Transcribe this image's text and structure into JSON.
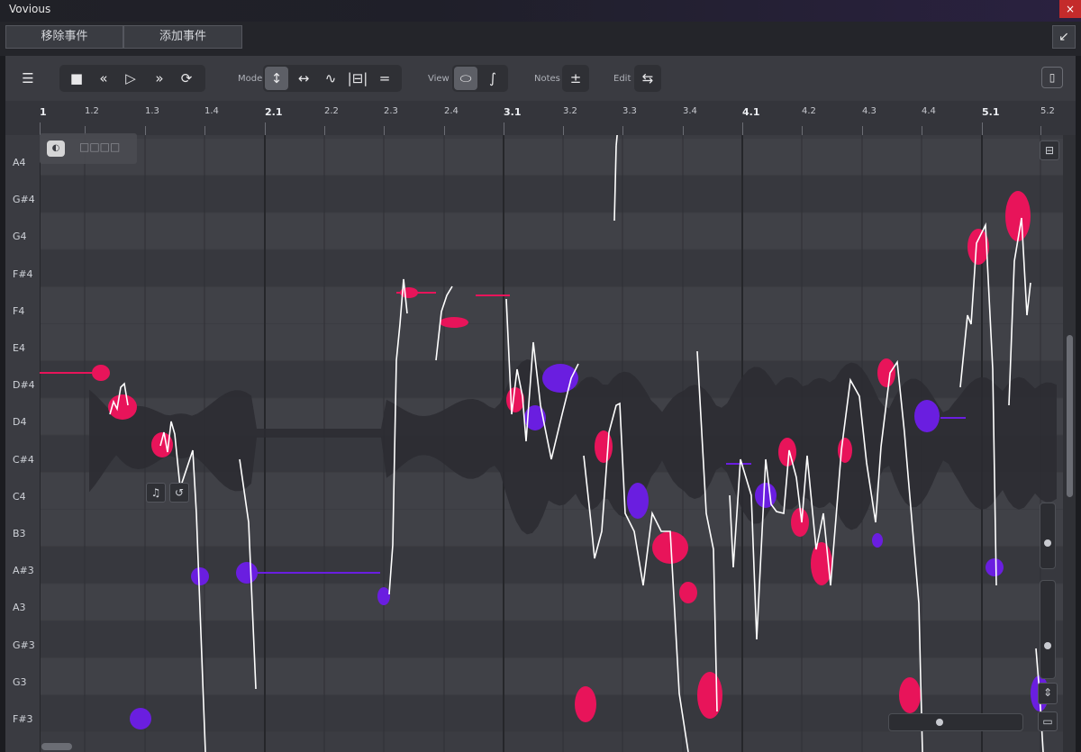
{
  "window": {
    "title": "Vovious",
    "close_label": "×"
  },
  "event_bar": {
    "remove_event": "移除事件",
    "add_event": "添加事件",
    "dock_icon": "arrow-down-left-icon"
  },
  "toolbar": {
    "menu_icon": "hamburger-icon",
    "transport": [
      "stop-icon",
      "rewind-icon",
      "play-icon",
      "fast-forward-icon",
      "loop-icon"
    ],
    "mode_label": "Mode",
    "mode_tools": [
      "pitch-vertical-icon",
      "time-horizontal-icon",
      "curve-tool-icon",
      "range-tool-icon",
      "equal-icon"
    ],
    "view_label": "View",
    "view_tools": [
      "blob-view-icon",
      "curve-view-icon"
    ],
    "notes_label": "Notes",
    "notes_icon": "plus-minus-icon",
    "edit_label": "Edit",
    "edit_icon": "swap-icon",
    "panel_icon": "side-panel-icon"
  },
  "ruler": {
    "ticks": [
      {
        "label": "1",
        "major": true
      },
      {
        "label": "1.2",
        "major": false
      },
      {
        "label": "1.3",
        "major": false
      },
      {
        "label": "1.4",
        "major": false
      },
      {
        "label": "2.1",
        "major": true
      },
      {
        "label": "2.2",
        "major": false
      },
      {
        "label": "2.3",
        "major": false
      },
      {
        "label": "2.4",
        "major": false
      },
      {
        "label": "3.1",
        "major": true
      },
      {
        "label": "3.2",
        "major": false
      },
      {
        "label": "3.3",
        "major": false
      },
      {
        "label": "3.4",
        "major": false
      },
      {
        "label": "4.1",
        "major": true
      },
      {
        "label": "4.2",
        "major": false
      },
      {
        "label": "4.3",
        "major": false
      },
      {
        "label": "4.4",
        "major": false
      },
      {
        "label": "5.1",
        "major": true
      },
      {
        "label": "5.2",
        "major": false
      }
    ]
  },
  "piano_keys": [
    "A4",
    "G#4",
    "G4",
    "F#4",
    "F4",
    "E4",
    "D#4",
    "D4",
    "C#4",
    "C4",
    "B3",
    "A#3",
    "A3",
    "G#3",
    "G3",
    "F#3"
  ],
  "overlay_tag": {
    "icon": "note-icon",
    "text": "□□□□"
  },
  "colors": {
    "note_pink": "#e8145a",
    "note_purple": "#6a1ee0",
    "pitch_line": "#ffffff",
    "waveform": "#2b2c31",
    "grid_bg": "#3b3c42"
  }
}
